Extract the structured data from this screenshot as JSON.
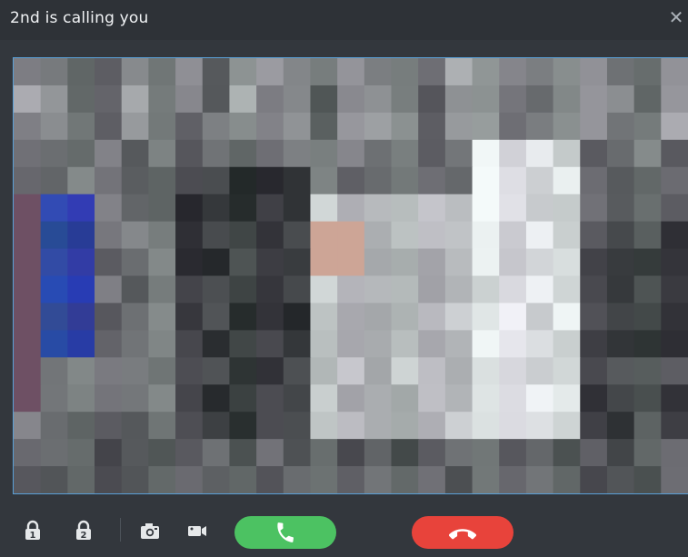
{
  "window": {
    "title": "2nd is calling you",
    "close_glyph": "✕"
  },
  "video": {
    "description_icon": "pixelated-video-feed"
  },
  "controls": {
    "icons": [
      "unlock-1-icon",
      "unlock-2-icon",
      "camera-snapshot-icon",
      "video-record-icon",
      "phone-answer-icon",
      "phone-hangup-icon"
    ],
    "answer_color": "#4cc262",
    "hangup_color": "#e8433b",
    "accent_border": "#5aa0d8"
  }
}
